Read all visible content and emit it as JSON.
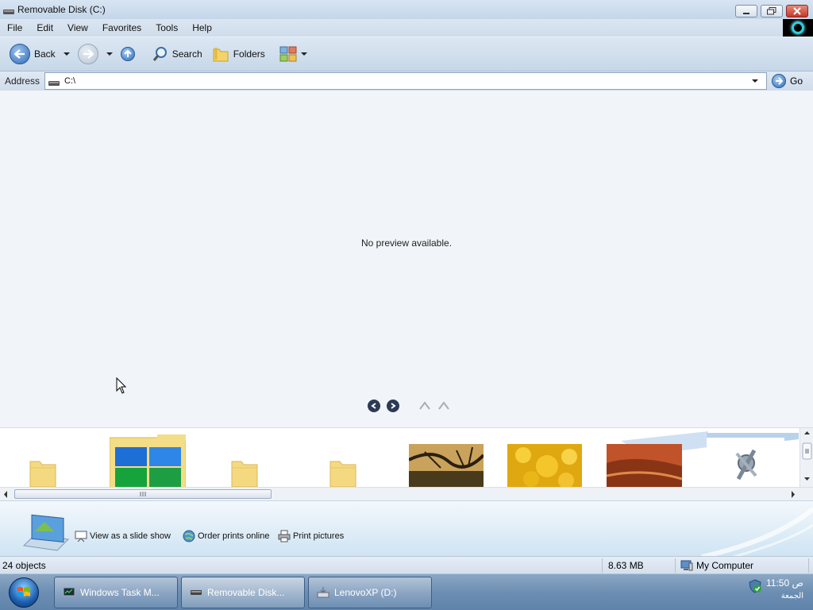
{
  "window": {
    "title": "Removable Disk (C:)"
  },
  "menu": {
    "items": [
      "File",
      "Edit",
      "View",
      "Favorites",
      "Tools",
      "Help"
    ]
  },
  "toolbar": {
    "back_label": "Back",
    "search_label": "Search",
    "folders_label": "Folders"
  },
  "address": {
    "label": "Address",
    "value": "C:\\",
    "go_label": "Go"
  },
  "preview": {
    "message": "No preview available."
  },
  "filmstrip": {
    "items": [
      {
        "kind": "folder",
        "icon": "folder-icon"
      },
      {
        "kind": "folder-with-image",
        "icon": "windows-folder-icon"
      },
      {
        "kind": "folder",
        "icon": "folder-icon"
      },
      {
        "kind": "folder",
        "icon": "folder-icon"
      },
      {
        "kind": "photo",
        "icon": "tree-photo"
      },
      {
        "kind": "photo",
        "icon": "yellow-flower-photo"
      },
      {
        "kind": "photo",
        "icon": "desert-photo"
      },
      {
        "kind": "photo",
        "icon": "tools-image"
      }
    ]
  },
  "tasks": {
    "slide_show": "View as a slide show",
    "order_prints": "Order prints online",
    "print": "Print pictures"
  },
  "status": {
    "objects": "24 objects",
    "size": "8.63 MB",
    "zone": "My Computer"
  },
  "taskbar": {
    "buttons": [
      {
        "label": "Windows Task M..."
      },
      {
        "label": "Removable Disk..."
      },
      {
        "label": "LenovoXP (D:)"
      }
    ],
    "time": "11:50 ص",
    "day": "الجمعة"
  },
  "colors": {
    "title_bg": "#c4d6ea",
    "taskbar": "#6d8eb3",
    "preview_bg": "#f1f4f8"
  }
}
